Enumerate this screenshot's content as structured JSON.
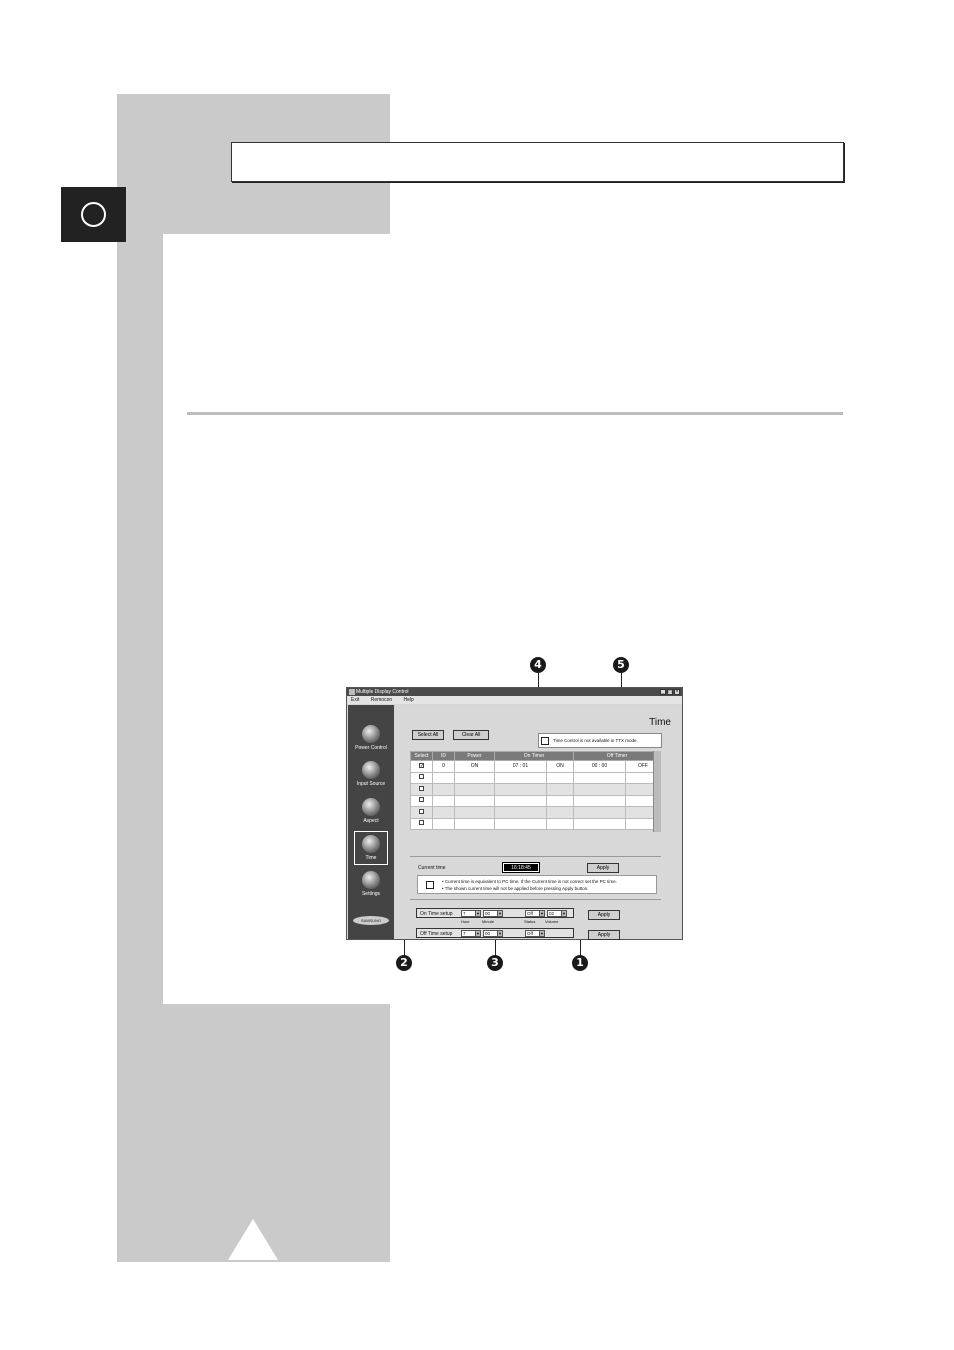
{
  "window": {
    "title": "Multiple Display Control",
    "menu": [
      "Exit",
      "Remocon",
      "Help"
    ],
    "sidebar": [
      "Power Control",
      "Input Source",
      "Aspect",
      "Time",
      "Settings"
    ],
    "logo": "SAMSUNG",
    "heading": "Time",
    "select_all": "Select All",
    "clear_all": "Clear All",
    "notice": "Time Control is not available in TTX mode.",
    "columns": [
      "Select",
      "ID",
      "Power",
      "On Timer",
      "Off Timer"
    ],
    "rows": [
      {
        "check": "✓",
        "id": "0",
        "power": "ON",
        "on1": "07 : 01",
        "on2": "ON",
        "off1": "00 : 00",
        "off2": "OFF"
      },
      {
        "check": "",
        "id": "",
        "power": "",
        "on1": "",
        "on2": "",
        "off1": "",
        "off2": ""
      },
      {
        "check": "",
        "id": "",
        "power": "",
        "on1": "",
        "on2": "",
        "off1": "",
        "off2": ""
      },
      {
        "check": "",
        "id": "",
        "power": "",
        "on1": "",
        "on2": "",
        "off1": "",
        "off2": ""
      },
      {
        "check": "",
        "id": "",
        "power": "",
        "on1": "",
        "on2": "",
        "off1": "",
        "off2": ""
      },
      {
        "check": "",
        "id": "",
        "power": "",
        "on1": "",
        "on2": "",
        "off1": "",
        "off2": ""
      }
    ],
    "current_time_label": "Current time",
    "current_time": "16:18:45",
    "apply": "Apply",
    "info1": "•  Current time is equivalent to PC time. If the Current time is not correct set the PC time.",
    "info2": "•  The shown current time will not be applied before pressing Apply button.",
    "on_setup": "On Time setup",
    "off_setup": "Off Time setup",
    "on_hour": "7",
    "on_minute": "00",
    "on_status": "Off",
    "on_volume": "02",
    "off_hour": "7",
    "off_minute": "00",
    "off_status": "Off",
    "sub_hour": "Hour",
    "sub_minute": "Minute",
    "sub_status": "Status",
    "sub_volume": "Volume"
  },
  "callouts": [
    "4",
    "5",
    "2",
    "3",
    "1"
  ]
}
